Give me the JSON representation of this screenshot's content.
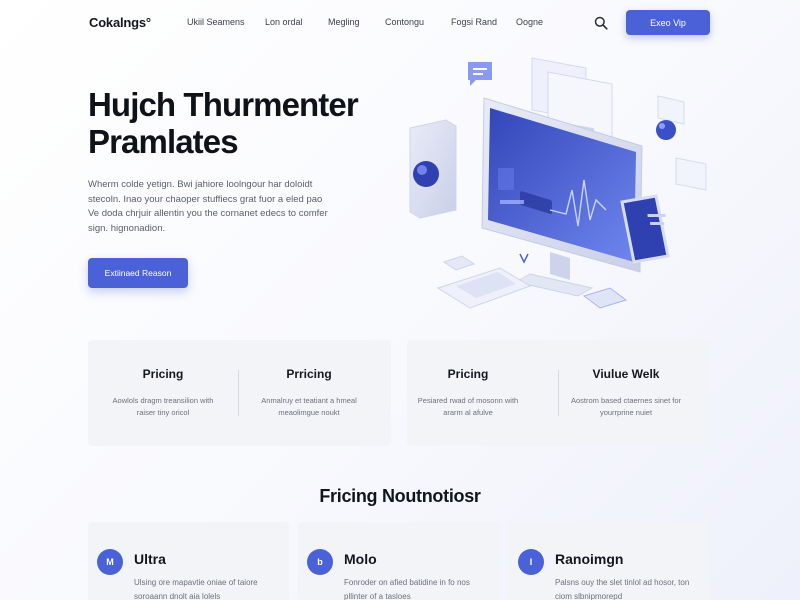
{
  "nav": {
    "logo": "Cokalngs°",
    "links": [
      "Ukiil Seamens",
      "Lon ordal",
      "Megling",
      "Contongu",
      "Fogsi Rand",
      "Oogne"
    ],
    "cta": "Exeo Vip"
  },
  "hero": {
    "title_line1": "Hujch Thurmenter",
    "title_line2": "Pramlates",
    "description": "Wherm colde yetign. Bwi jahiore loolngour har doloidt stecoln. Inao your chaoper stuffiecs grat fuor a eled pao Ve doda chrjuir allentin you the cornanet edecs to comfer sign. hignonadion.",
    "button": "Extiinaed Reason"
  },
  "features": [
    {
      "title": "Pricing",
      "desc": "Aowlols dragm treansilion with raiser tiny oricol"
    },
    {
      "title": "Prricing",
      "desc": "Anmalruy et teatiant a hmeal meaolimgue noukt"
    },
    {
      "title": "Pricing",
      "desc": "Pesiared rwad of mosonn with ararm al afulve"
    },
    {
      "title": "Viulue Welk",
      "desc": "Aostrom based ctaernes sinet for yourrprine nuiet"
    }
  ],
  "section": {
    "title": "Fricing Noutnotiosr"
  },
  "pricing": [
    {
      "icon": "M",
      "name": "Ultra",
      "desc": "Ulsing ore mapavtie oniae of taiore soroaann dnolt aia lolels"
    },
    {
      "icon": "b",
      "name": "Molo",
      "desc": "Fonroder on afied batidine in fo nos pllinter of a tasloes"
    },
    {
      "icon": "I",
      "name": "Ranoimgn",
      "desc": "Palsns ouy the slet tinlol ad hosor, ton ciom slbnipmorepd"
    }
  ],
  "colors": {
    "accent": "#4b61d8",
    "card_bg": "#f3f4f8",
    "text": "#14161f"
  }
}
